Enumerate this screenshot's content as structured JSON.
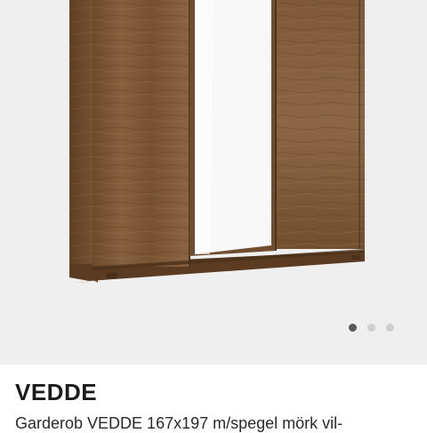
{
  "product": {
    "brand": "VEDDE",
    "title": "Garderob VEDDE 167x197 m/spegel mörk vil-"
  },
  "gallery": {
    "image_icon": "wardrobe-product-photo",
    "total_images": 3,
    "active_index": 0
  },
  "colors": {
    "wood": "#7a5536",
    "mirror": "#f7f7f7",
    "background": "#efefef",
    "dot_active": "#5a5a5a",
    "dot_inactive": "#cfcfcf"
  }
}
